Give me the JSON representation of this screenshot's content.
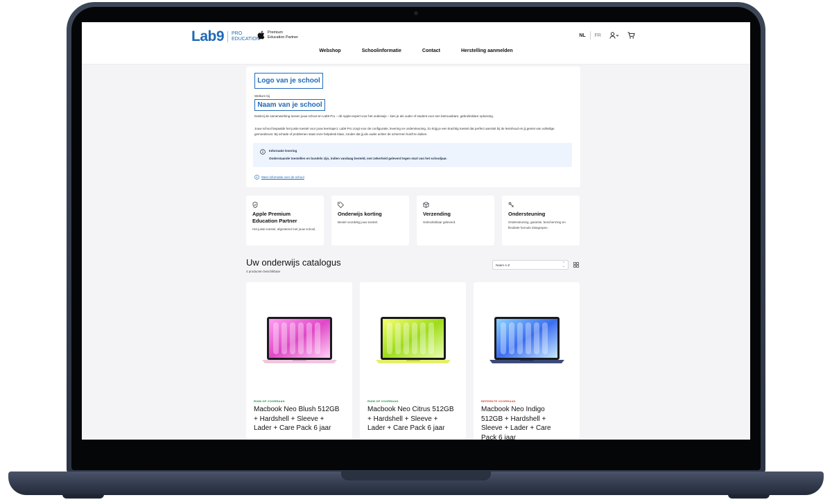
{
  "header": {
    "brand_logo": "Lab9",
    "brand_sub_1": "PRO",
    "brand_sub_2": "EDUCATION",
    "partner_line_1": "Premium",
    "partner_line_2": "Education Partner",
    "lang_active": "NL",
    "lang_other": "FR",
    "nav": [
      "Webshop",
      "Schoolinformatie",
      "Contact",
      "Herstelling aanmelden"
    ]
  },
  "school": {
    "logo_placeholder": "Logo van je school",
    "welcome": "Welkom bij",
    "name_placeholder": "Naam van je school",
    "intro_1": "Dankzij de samenwerking tussen jouw school en Lab9 Pro – dé Apple-expert voor het onderwijs – kies je als ouder of student voor een betrouwbare, gebruiksklare oplossing.",
    "intro_2": "Jouw school bepaalde het juiste toestel voor jouw leertraject, Lab9 Pro zorgt voor de configuratie, levering en ondersteuning. Zo krijg je een krachtig toestel dat perfect aansluit bij de lesinhoud en jij geniet van volledige gemoedsrust. Bij schade of problemen staat onze helpdesk klaar, zonder dat jij als ouder achter de schermen hoeft te duiken.",
    "info_title": "Informatie levering",
    "info_text": "Onderstaande toestellen en bundels zijn, indien vandaag besteld, met zekerheid geleverd tegen start van het schooljaar.",
    "more_link": "Meer informatie over de school"
  },
  "features": [
    {
      "icon": "shield-icon",
      "title": "Apple Premium Education Partner",
      "desc": "Het juiste toestel, afgestemd met jouw school."
    },
    {
      "icon": "tag-icon",
      "title": "Onderwijs korting",
      "desc": "Bestel voordelig jouw toestel."
    },
    {
      "icon": "box-icon",
      "title": "Verzending",
      "desc": "Gebruiksklaar geleverd."
    },
    {
      "icon": "support-icon",
      "title": "Ondersteuning",
      "desc": "Ondersteuning, garantie, bescherming en flexibele formule inbegrepen."
    }
  ],
  "catalog": {
    "title": "Uw onderwijs catalogus",
    "count": "4 producten beschikbaar",
    "sort_value": "Naam A-Z"
  },
  "products": [
    {
      "stock": "RUIM OP VOORRAAD",
      "stock_color": "#1f8a4c",
      "name": "Macbook Neo Blush 512GB + Hardshell + Sleeve + Lader + Care Pack 6 jaar",
      "accent": "#e05ac8"
    },
    {
      "stock": "RUIM OP VOORRAAD",
      "stock_color": "#1f8a4c",
      "name": "Macbook Neo Citrus 512GB + Hardshell + Sleeve + Lader + Care Pack 6 jaar",
      "accent": "#c8e020"
    },
    {
      "stock": "BEPERKTE VOORRAAD",
      "stock_color": "#d4432f",
      "name": "Macbook Neo Indigo 512GB + Hardshell + Sleeve + Lader + Care Pack 6 jaar",
      "accent": "#4a7ef0"
    }
  ],
  "colors": {
    "brand_blue": "#1e6ab8",
    "info_bg": "#eef4fd",
    "frame": "#2c3444"
  }
}
